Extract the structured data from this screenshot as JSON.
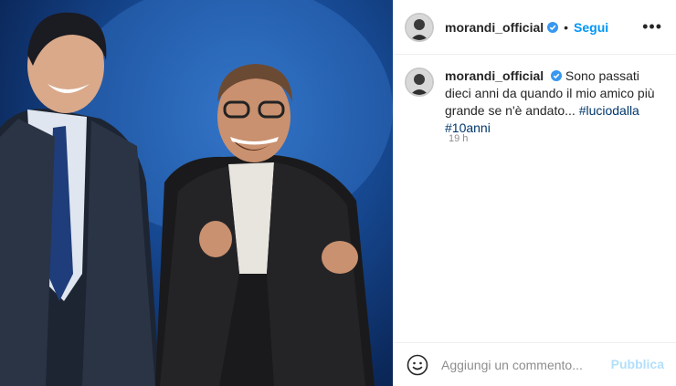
{
  "post": {
    "username": "morandi_official",
    "follow_label": "Segui",
    "separator": "•",
    "more_label": "•••",
    "caption_username": "morandi_official",
    "caption_text": "Sono passati dieci anni da quando il mio amico più grande se n'è andato...",
    "hashtags": [
      "#luciodalla",
      "#10anni"
    ],
    "time": "19 h",
    "comment_placeholder": "Aggiungi un commento...",
    "publish_label": "Pubblica"
  },
  "colors": {
    "accent": "#0095f6",
    "hashtag": "#00376b",
    "muted": "#8e8e8e",
    "publish_disabled": "#b2dffc"
  },
  "icons": {
    "verified": "verified-badge-icon",
    "more": "more-options-icon",
    "emoji": "emoji-icon"
  }
}
